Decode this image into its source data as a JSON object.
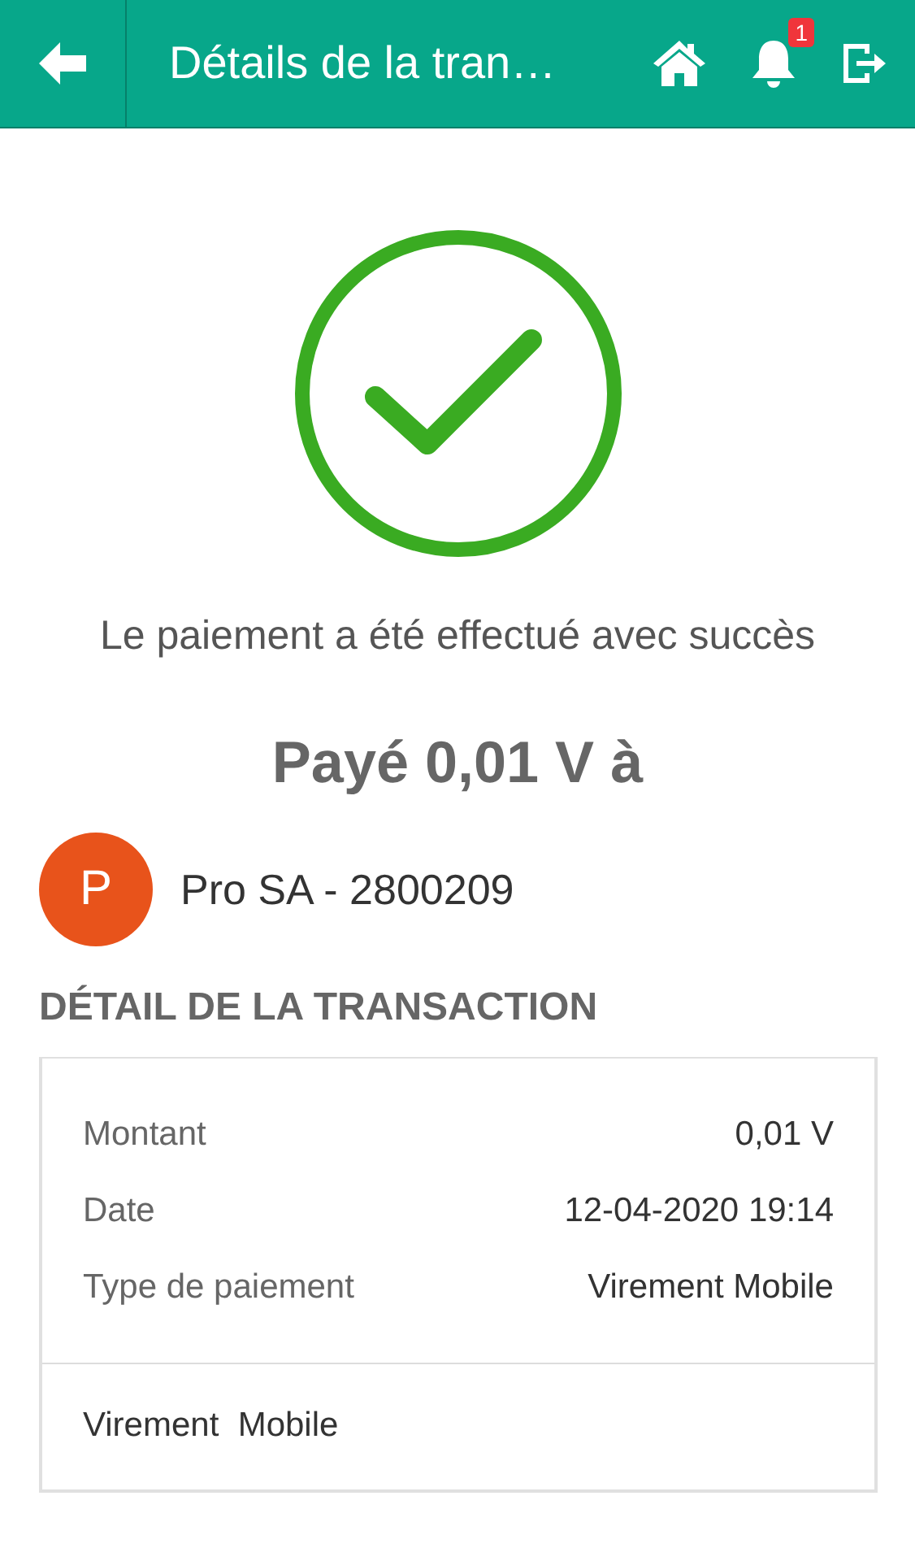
{
  "header": {
    "title": "Détails de la tran…",
    "notification_count": "1"
  },
  "status": {
    "message": "Le paiement a été effectué avec succès",
    "amount_line": "Payé 0,01 V à"
  },
  "recipient": {
    "initial": "P",
    "name": "Pro SA - 2800209"
  },
  "section_title": "DÉTAIL DE LA TRANSACTION",
  "details": [
    {
      "label": "Montant",
      "value": "0,01 V"
    },
    {
      "label": "Date",
      "value": "12-04-2020 19:14"
    },
    {
      "label": "Type de paiement",
      "value": "Virement Mobile"
    }
  ],
  "note": "Virement  Mobile"
}
